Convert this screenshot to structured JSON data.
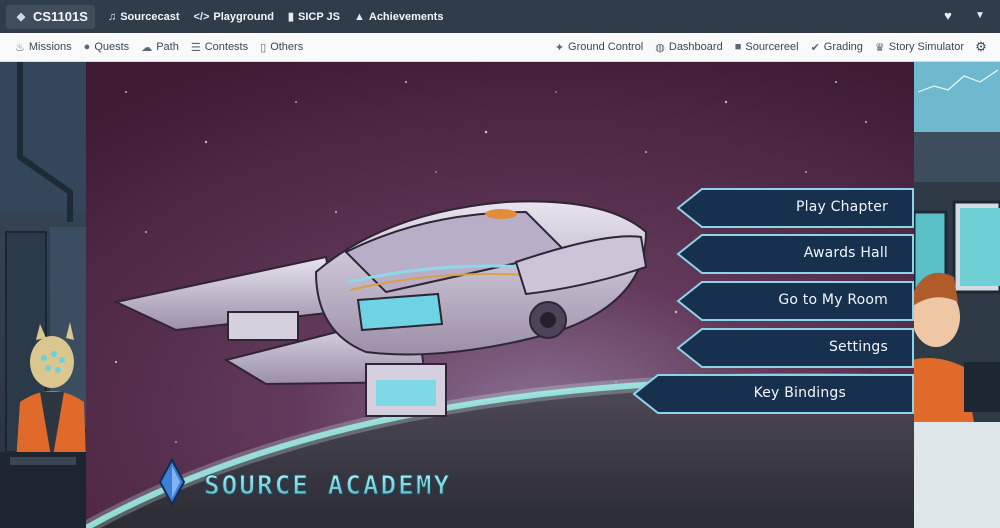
{
  "topbar": {
    "brand": {
      "label": "CS1101S",
      "icon": "diamond-icon"
    },
    "links": [
      {
        "label": "Sourcecast",
        "icon": "music-icon"
      },
      {
        "label": "Playground",
        "icon": "code-icon"
      },
      {
        "label": "SICP JS",
        "icon": "book-icon"
      },
      {
        "label": "Achievements",
        "icon": "mountain-icon"
      }
    ],
    "right_icons": [
      "heart-icon",
      "caret-down-icon"
    ]
  },
  "subbar": {
    "left": [
      {
        "label": "Missions",
        "icon": "flame-icon"
      },
      {
        "label": "Quests",
        "icon": "lightbulb-icon"
      },
      {
        "label": "Path",
        "icon": "predictive-icon"
      },
      {
        "label": "Contests",
        "icon": "comparison-icon"
      },
      {
        "label": "Others",
        "icon": "manual-icon"
      }
    ],
    "right": [
      {
        "label": "Ground Control",
        "icon": "satellite-icon"
      },
      {
        "label": "Dashboard",
        "icon": "globe-icon"
      },
      {
        "label": "Sourcereel",
        "icon": "video-icon"
      },
      {
        "label": "Grading",
        "icon": "tick-circle-icon"
      },
      {
        "label": "Story Simulator",
        "icon": "crown-icon"
      }
    ],
    "settings_icon": "sliders-icon"
  },
  "game_menu": {
    "buttons": [
      "Play Chapter",
      "Awards Hall",
      "Go to My Room",
      "Settings",
      "Key Bindings"
    ]
  },
  "logo": {
    "text": "SOURCE ACADEMY"
  },
  "colors": {
    "topbar": "#2f3d4b",
    "subbar": "#f8f9fa",
    "sky": "#4a1e3a",
    "button_fill": "#17304e",
    "button_border": "#8fd3e8",
    "logo_cyan": "#8fe7ee"
  }
}
